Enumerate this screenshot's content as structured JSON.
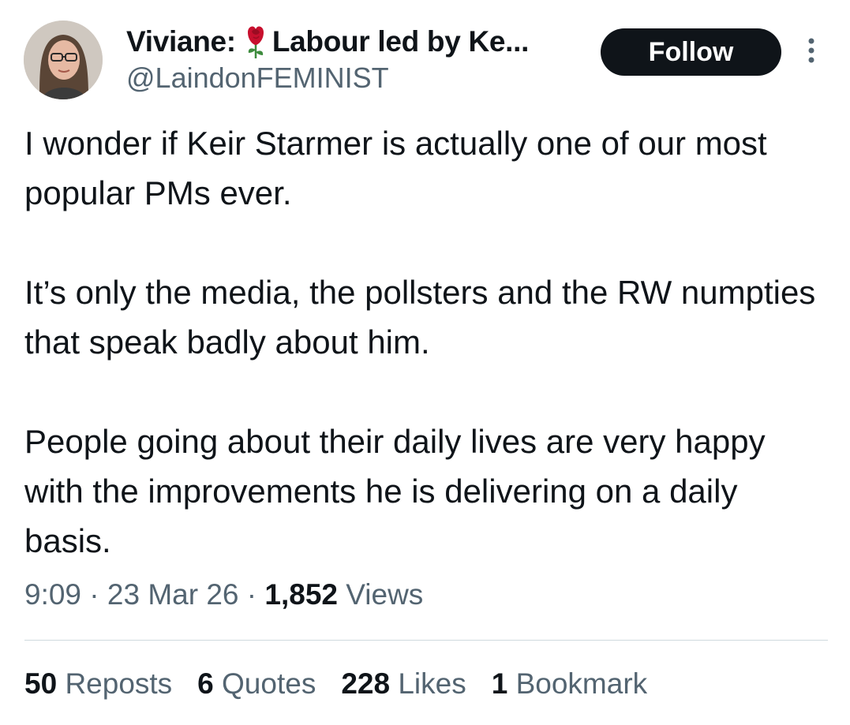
{
  "tweet": {
    "author": {
      "display_name_prefix": "Viviane:",
      "display_name_suffix": "Labour led by Ke...",
      "emoji_icon": "rose-icon",
      "handle": "@LaindonFEMINIST"
    },
    "follow_label": "Follow",
    "paragraphs": [
      "I wonder if Keir Starmer is actually one of our most popular PMs ever.",
      "It’s only the media, the pollsters and the RW numpties that speak badly about him.",
      "People going about their daily lives are very happy with the improvements he is delivering on a daily basis."
    ],
    "meta": {
      "time": "9:09",
      "sep1": " · ",
      "date": "23 Mar 26",
      "sep2": " · ",
      "views_count": "1,852",
      "views_label": "Views"
    },
    "stats": {
      "reposts_count": "50",
      "reposts_label": "Reposts",
      "quotes_count": "6",
      "quotes_label": "Quotes",
      "likes_count": "228",
      "likes_label": "Likes",
      "bookmarks_count": "1",
      "bookmarks_label": "Bookmark"
    }
  },
  "colors": {
    "text_primary": "#0f1419",
    "text_secondary": "#536471",
    "divider": "#cfd9de",
    "follow_bg": "#0f1419",
    "rose_red": "#c8102e"
  }
}
